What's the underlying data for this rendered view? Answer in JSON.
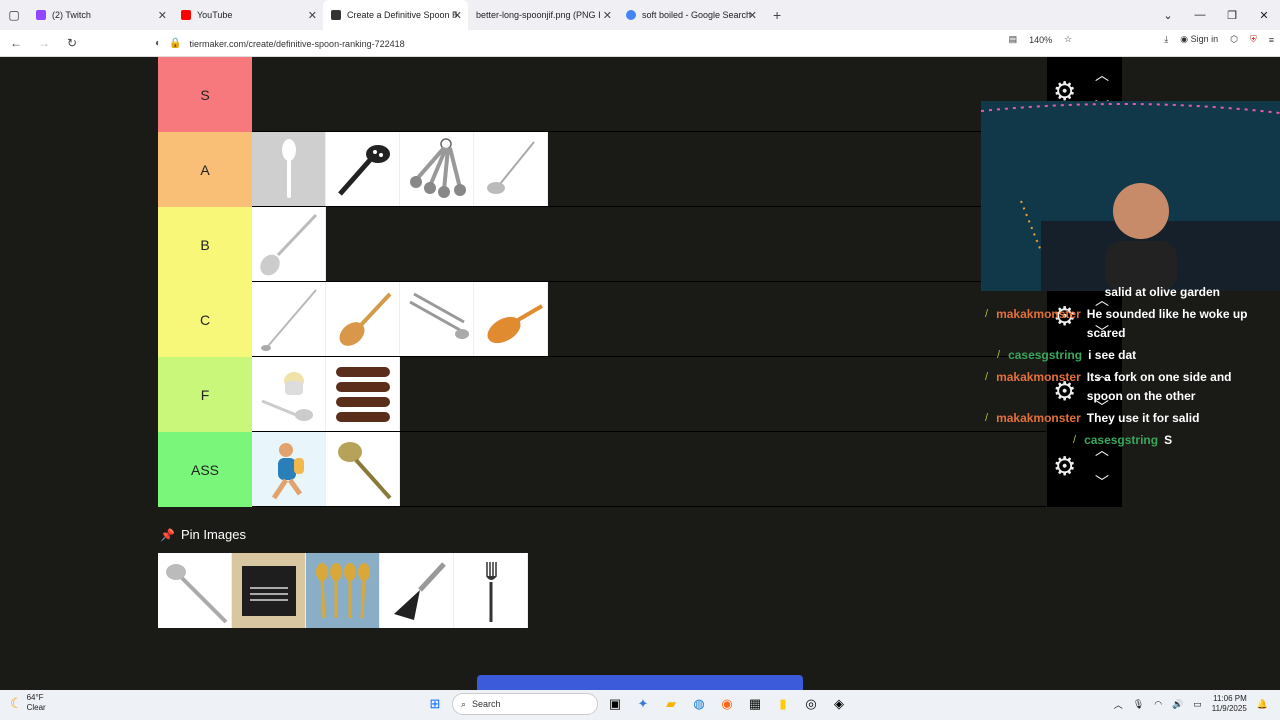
{
  "browser": {
    "tabs": [
      {
        "label": "(2) Twitch",
        "color": "#9146ff"
      },
      {
        "label": "YouTube",
        "color": "#ff0000"
      },
      {
        "label": "Create a Definitive Spoon Rank",
        "color": "#333333",
        "active": true
      },
      {
        "label": "better-long-spoonjif.png (PNG Ima",
        "color": "#888888"
      },
      {
        "label": "soft boiled - Google Search",
        "color": "#4285f4"
      }
    ],
    "url": "tiermaker.com/create/definitive-spoon-ranking-722418",
    "zoom": "140%",
    "sign_in": "Sign in"
  },
  "tiers": [
    {
      "label": "S",
      "color": "#f7797d",
      "items": []
    },
    {
      "label": "A",
      "color": "#f9bf76",
      "items": [
        "plastic-spoon",
        "pasta-server",
        "measuring-spoons",
        "ladle"
      ]
    },
    {
      "label": "B",
      "color": "#f9f778",
      "items": [
        "slotted-spoon"
      ]
    },
    {
      "label": "C",
      "color": "#f7f779",
      "items": [
        "long-spoon",
        "wooden-spoon",
        "tongs",
        "wooden-spatula"
      ]
    },
    {
      "label": "F",
      "color": "#c9f779",
      "items": [
        "egg-spoon",
        "chocolate-spoons"
      ]
    },
    {
      "label": "ASS",
      "color": "#7af77b",
      "items": [
        "cartoon-figure",
        "serving-spoon"
      ]
    }
  ],
  "pin": {
    "label": "Pin Images",
    "items": [
      "silver-spoon",
      "cutlery-box",
      "gold-spoons",
      "pie-server",
      "fork"
    ]
  },
  "chat": [
    {
      "user": "",
      "message": "salid at olive garden",
      "user_color": "#e2703a"
    },
    {
      "user": "makakmonster",
      "message": "He sounded like he woke up scared",
      "user_color": "#e2703a"
    },
    {
      "user": "casesgstring",
      "message": "i see dat",
      "user_color": "#3aa65a"
    },
    {
      "user": "makakmonster",
      "message": "Its a fork on one side and spoon on the other",
      "user_color": "#e2703a"
    },
    {
      "user": "makakmonster",
      "message": "They use it for salid",
      "user_color": "#e2703a"
    },
    {
      "user": "casesgstring",
      "message": "S",
      "user_color": "#3aa65a"
    }
  ],
  "taskbar": {
    "temp": "64°F",
    "condition": "Clear",
    "search": "Search",
    "time": "11:06 PM",
    "date": "11/9/2025"
  }
}
